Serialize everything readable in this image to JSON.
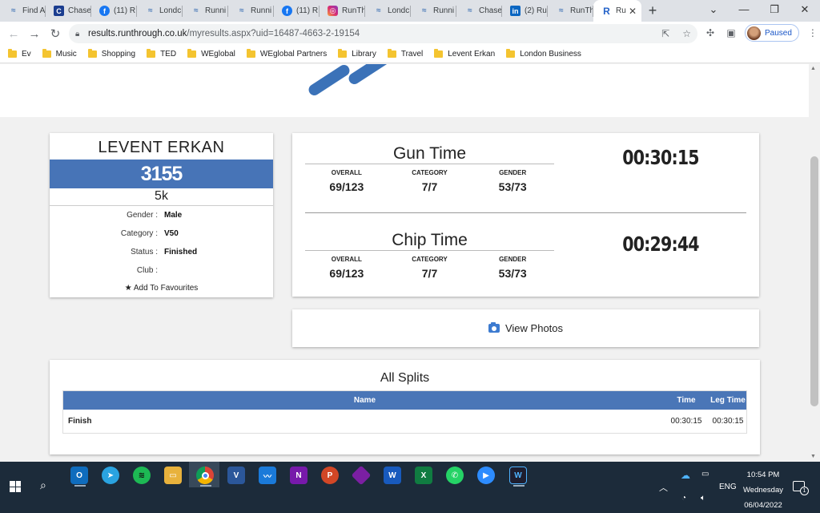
{
  "browser": {
    "tabs": [
      {
        "icon": "runthrough-icon",
        "glyph": "≈",
        "cls": "rt",
        "label": "Find A"
      },
      {
        "icon": "chase-icon",
        "glyph": "C",
        "cls": "ch",
        "label": "Chase"
      },
      {
        "icon": "facebook-icon",
        "glyph": "f",
        "cls": "fb",
        "label": "(11) R"
      },
      {
        "icon": "runthrough-icon",
        "glyph": "≈",
        "cls": "rt",
        "label": "Londc"
      },
      {
        "icon": "runthrough-icon",
        "glyph": "≈",
        "cls": "rt",
        "label": "Runni"
      },
      {
        "icon": "runthrough-icon",
        "glyph": "≈",
        "cls": "rt",
        "label": "Runni"
      },
      {
        "icon": "facebook-icon",
        "glyph": "f",
        "cls": "fb",
        "label": "(11) R"
      },
      {
        "icon": "instagram-icon",
        "glyph": "◎",
        "cls": "ig",
        "label": "RunTh"
      },
      {
        "icon": "runthrough-icon",
        "glyph": "≈",
        "cls": "rt",
        "label": "Londc"
      },
      {
        "icon": "runthrough-icon",
        "glyph": "≈",
        "cls": "rt",
        "label": "Runni"
      },
      {
        "icon": "runthrough-icon",
        "glyph": "≈",
        "cls": "rt",
        "label": "Chase"
      },
      {
        "icon": "linkedin-icon",
        "glyph": "in",
        "cls": "li",
        "label": "(2) Ru"
      },
      {
        "icon": "runthrough-icon",
        "glyph": "≈",
        "cls": "rt",
        "label": "RunTh"
      },
      {
        "icon": "runthrough-r-icon",
        "glyph": "R",
        "cls": "r",
        "label": "Ru",
        "active": true
      }
    ],
    "url_host": "results.runthrough.co.uk",
    "url_path": "/myresults.aspx?uid=16487-4663-2-19154",
    "profile_status": "Paused",
    "bookmarks": [
      "Ev",
      "Music",
      "Shopping",
      "TED",
      "WEglobal",
      "WEglobal Partners",
      "Library",
      "Travel",
      "Levent Erkan",
      "London Business"
    ]
  },
  "athlete": {
    "name": "LEVENT ERKAN",
    "bib": "3155",
    "race": "5k",
    "details": [
      {
        "label": "Gender :",
        "value": "Male"
      },
      {
        "label": "Category :",
        "value": "V50"
      },
      {
        "label": "Status :",
        "value": "Finished"
      },
      {
        "label": "Club :",
        "value": ""
      }
    ],
    "favourites_label": "Add To Favourites"
  },
  "times": {
    "gun": {
      "title": "Gun Time",
      "time": "00:30:15",
      "stats": [
        {
          "label": "OVERALL",
          "value": "69/123"
        },
        {
          "label": "CATEGORY",
          "value": "7/7"
        },
        {
          "label": "GENDER",
          "value": "53/73"
        }
      ]
    },
    "chip": {
      "title": "Chip Time",
      "time": "00:29:44",
      "stats": [
        {
          "label": "OVERALL",
          "value": "69/123"
        },
        {
          "label": "CATEGORY",
          "value": "7/7"
        },
        {
          "label": "GENDER",
          "value": "53/73"
        }
      ]
    }
  },
  "photos": {
    "label": "View Photos"
  },
  "splits": {
    "title": "All Splits",
    "headers": {
      "name": "Name",
      "time": "Time",
      "leg": "Leg Time"
    },
    "rows": [
      {
        "name": "Finish",
        "time": "00:30:15",
        "leg": "00:30:15"
      }
    ]
  },
  "taskbar": {
    "lang": "ENG",
    "time": "10:54 PM",
    "day": "Wednesday",
    "date": "06/04/2022",
    "notifications": "1"
  },
  "colors": {
    "accent": "#4774b7",
    "logo": "#3b72b8"
  }
}
